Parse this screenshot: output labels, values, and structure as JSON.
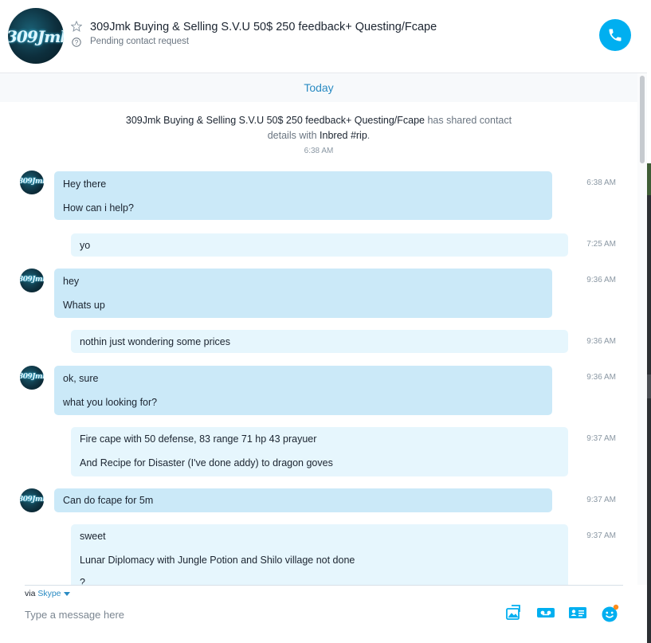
{
  "header": {
    "contact_name": "309Jmk Buying & Selling S.V.U 50$ 250 feedback+ Questing/Fcape",
    "status": "Pending contact request",
    "avatar_text": "309Jmk"
  },
  "conversation": {
    "day_label": "Today",
    "system": {
      "name": "309Jmk Buying & Selling S.V.U 50$ 250 feedback+ Questing/Fcape",
      "middle": " has shared contact details with ",
      "target": "Inbred #rip",
      "end": ".",
      "time": "6:38 AM"
    },
    "messages": [
      {
        "direction": "in",
        "lines": [
          "Hey there",
          "How can i help?"
        ],
        "time": "6:38 AM"
      },
      {
        "direction": "out",
        "lines": [
          "yo"
        ],
        "time": "7:25 AM"
      },
      {
        "direction": "in",
        "lines": [
          "hey",
          "Whats up"
        ],
        "time": "9:36 AM"
      },
      {
        "direction": "out",
        "lines": [
          "nothin just wondering some prices"
        ],
        "time": "9:36 AM"
      },
      {
        "direction": "in",
        "lines": [
          "ok, sure",
          "what you looking for?"
        ],
        "time": "9:36 AM"
      },
      {
        "direction": "out",
        "lines": [
          "Fire cape with 50 defense, 83 range 71 hp 43 prayuer",
          "And Recipe for Disaster (I've done addy) to dragon goves"
        ],
        "time": "9:37 AM"
      },
      {
        "direction": "in",
        "lines": [
          "Can do fcape for 5m"
        ],
        "time": "9:37 AM"
      },
      {
        "direction": "out",
        "lines": [
          "sweet",
          "Lunar Diplomacy with Jungle Potion and Shilo village not done",
          "?"
        ],
        "time": "9:37 AM"
      }
    ]
  },
  "composer": {
    "via_prefix": "via ",
    "via_service": "Skype",
    "placeholder": "Type a message here"
  },
  "colors": {
    "accent": "#00aff0",
    "incoming_bubble": "#cbe9f8",
    "outgoing_bubble": "#e6f6fd",
    "link": "#2a8bc3"
  },
  "icons": [
    "star-icon",
    "question-icon",
    "phone-icon",
    "image-share-icon",
    "video-message-icon",
    "contact-card-icon",
    "emoticon-icon"
  ]
}
